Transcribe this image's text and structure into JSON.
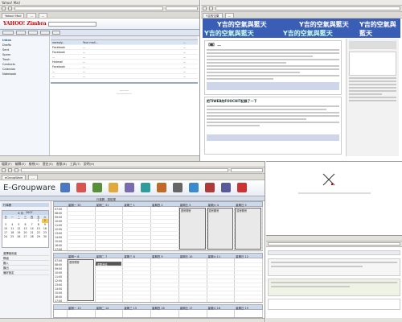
{
  "mail": {
    "window_title": "Yahoo! Mail",
    "logo": "YAHOO! Zimbra",
    "search_placeholder": "",
    "toolbar": [
      "New",
      "Reply",
      "Forward",
      "Delete",
      "Print"
    ],
    "folders": [
      "Inbox",
      "Drafts",
      "Sent",
      "Spam",
      "Trash",
      "Contacts",
      "Calendar",
      "Notebook"
    ],
    "messages": [
      {
        "from": "noreply...",
        "subject": "Your mail...",
        "date": "..."
      },
      {
        "from": "Facebook",
        "subject": "...",
        "date": "..."
      },
      {
        "from": "Facebook",
        "subject": "...",
        "date": "..."
      },
      {
        "from": "...",
        "subject": "...",
        "date": "..."
      },
      {
        "from": "Hotmail",
        "subject": "...",
        "date": "..."
      },
      {
        "from": "Facebook",
        "subject": "...",
        "date": "..."
      },
      {
        "from": "...",
        "subject": "...",
        "date": "..."
      },
      {
        "from": "...",
        "subject": "...",
        "date": "..."
      }
    ]
  },
  "blog": {
    "banner": "Y吉的空氣與藍天",
    "post1_title": "【轉】 ...",
    "post2_title": "把TIWEB的FOOCHIT記錄了一下",
    "sidebar_title": "..."
  },
  "groupware": {
    "logo": "E-Groupware",
    "menu": [
      "檔案(F)",
      "編輯(E)",
      "檢視(V)",
      "歷史(S)",
      "書籤(B)",
      "工具(T)",
      "說明(H)"
    ],
    "calendar_title": "行事曆 - 週檢視",
    "header_info": "每週 - 2007/6/2",
    "sidebar": {
      "nav_title": "行事曆",
      "month": "6 月",
      "year": "2007",
      "days_of_week": [
        "日",
        "一",
        "二",
        "三",
        "四",
        "五",
        "六"
      ],
      "calendar_days": [
        "",
        "",
        "",
        "",
        "",
        "1",
        "2",
        "3",
        "4",
        "5",
        "6",
        "7",
        "8",
        "9",
        "10",
        "11",
        "12",
        "13",
        "14",
        "15",
        "16",
        "17",
        "18",
        "19",
        "20",
        "21",
        "22",
        "23",
        "24",
        "25",
        "26",
        "27",
        "28",
        "29",
        "30",
        "",
        "",
        "",
        "",
        "",
        "",
        "",
        ""
      ],
      "sections": [
        "選擇使用者",
        "群組",
        "匯入",
        "匯出",
        "偏好設定"
      ]
    },
    "week1": {
      "days": [
        "星期一 30",
        "星期二 31",
        "星期三 1",
        "星期四 2",
        "星期五 3",
        "星期六 4",
        "星期日 5"
      ],
      "times": [
        "07:00",
        "08:00",
        "09:00",
        "10:00",
        "11:00",
        "12:00",
        "13:00",
        "14:00",
        "15:00",
        "16:00",
        "17:00"
      ],
      "events": [
        "週會開會",
        "週會開會",
        "週會開會"
      ]
    },
    "week2": {
      "days": [
        "星期一 6",
        "星期二 7",
        "星期三 8",
        "星期四 9",
        "星期五 10",
        "星期六 11",
        "星期日 12"
      ],
      "times": [
        "07:00",
        "08:00",
        "09:00",
        "10:00",
        "11:00",
        "12:00",
        "13:00",
        "14:00",
        "15:00",
        "16:00",
        "17:00"
      ],
      "events": [
        "週會開會",
        "重要會議"
      ]
    },
    "week3": {
      "days": [
        "星期一 13",
        "星期二 14",
        "星期三 15",
        "星期四 16",
        "星期五 17",
        "星期六 18",
        "星期日 19"
      ]
    }
  },
  "colors": {
    "blog_blue": "#3355aa",
    "cal_header": "#c9d8ea",
    "event_dark": "#333333",
    "mail_blue": "#336699"
  }
}
